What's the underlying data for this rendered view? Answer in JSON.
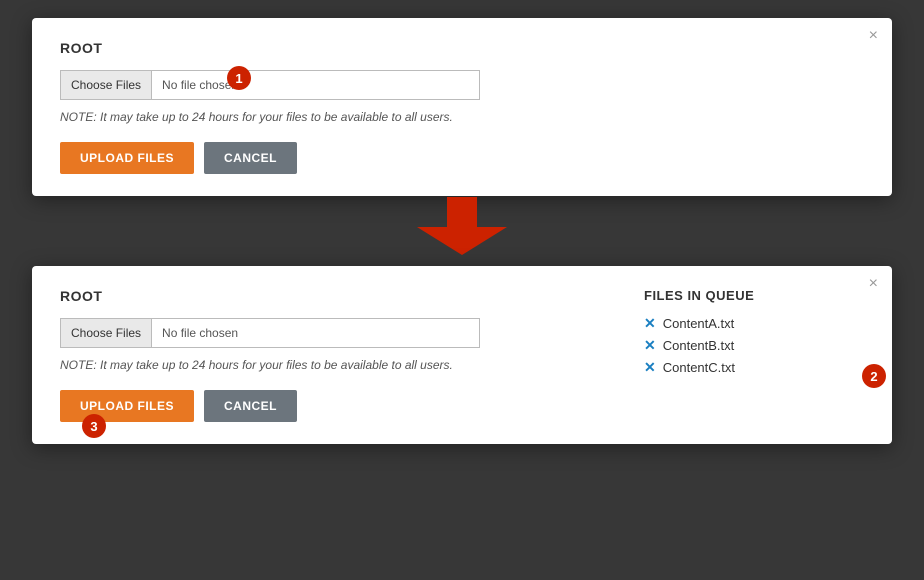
{
  "dialogs": {
    "top": {
      "title": "ROOT",
      "close_label": "×",
      "file_input": {
        "button_label": "Choose Files",
        "no_file_text": "No file chosen"
      },
      "note": "NOTE: It may take up to 24 hours for your files to be available to all users.",
      "upload_button": "UPLOAD FILES",
      "cancel_button": "CANCEL"
    },
    "bottom": {
      "title": "ROOT",
      "close_label": "×",
      "file_input": {
        "button_label": "Choose Files",
        "no_file_text": "No file chosen"
      },
      "note": "NOTE: It may take up to 24 hours for your files to be available to all users.",
      "upload_button": "UPLOAD FILES",
      "cancel_button": "CANCEL",
      "queue": {
        "title": "FILES IN QUEUE",
        "items": [
          {
            "name": "ContentA.txt"
          },
          {
            "name": "ContentB.txt"
          },
          {
            "name": "ContentC.txt"
          }
        ]
      }
    }
  },
  "badges": {
    "one": "1",
    "two": "2",
    "three": "3"
  },
  "colors": {
    "upload_btn": "#e87722",
    "cancel_btn": "#6c757d",
    "badge": "#cc2200",
    "arrow": "#cc2200",
    "x_icon": "#1a7fc1"
  }
}
